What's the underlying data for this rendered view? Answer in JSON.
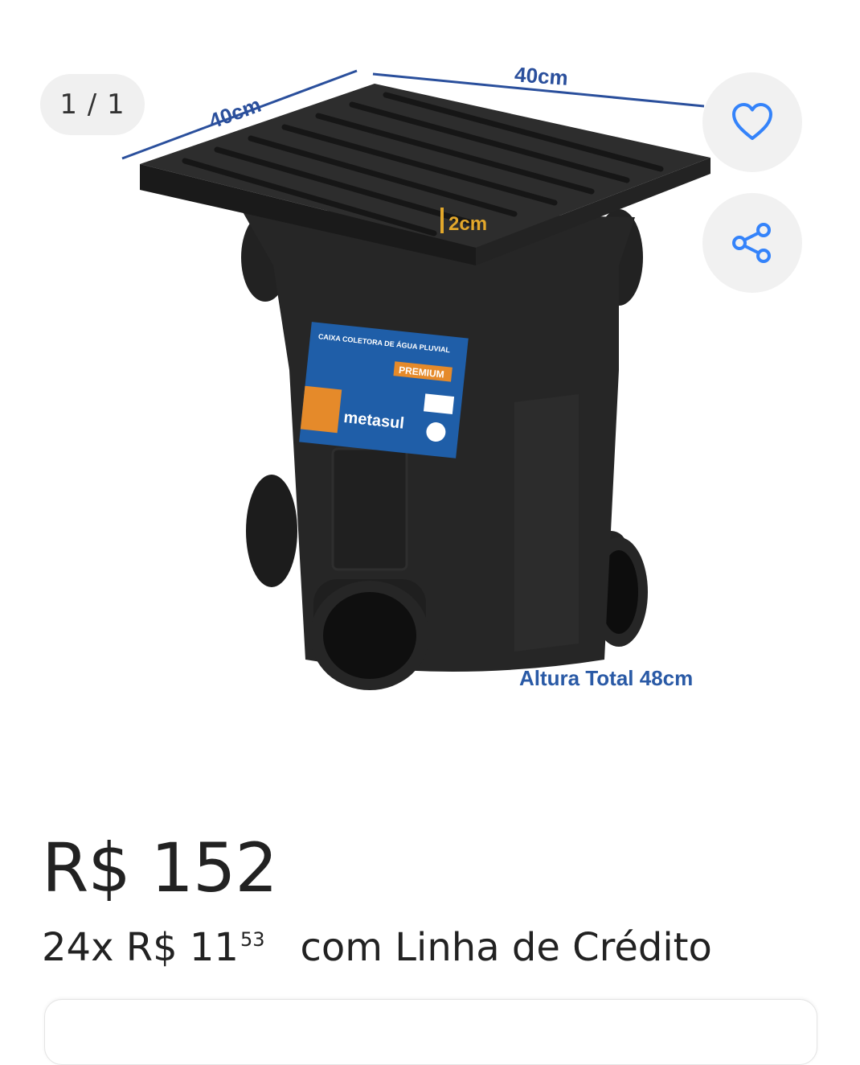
{
  "gallery": {
    "counter": "1 / 1",
    "favorite_icon": "heart-outline-icon",
    "share_icon": "share-icon",
    "accent_color": "#3483fa",
    "image": {
      "dim_top_left": "40cm",
      "dim_top_right": "40cm",
      "dim_rim": "2cm",
      "height_label": "Altura Total 48cm",
      "label_title": "CAIXA COLETORA DE ÁGUA PLUVIAL",
      "label_badge": "PREMIUM",
      "brand": "metasul"
    }
  },
  "price": {
    "main": "R$ 152",
    "installment_count": "24x R$ 11",
    "installment_cents": "53",
    "installment_method": "com Linha de Crédito"
  }
}
